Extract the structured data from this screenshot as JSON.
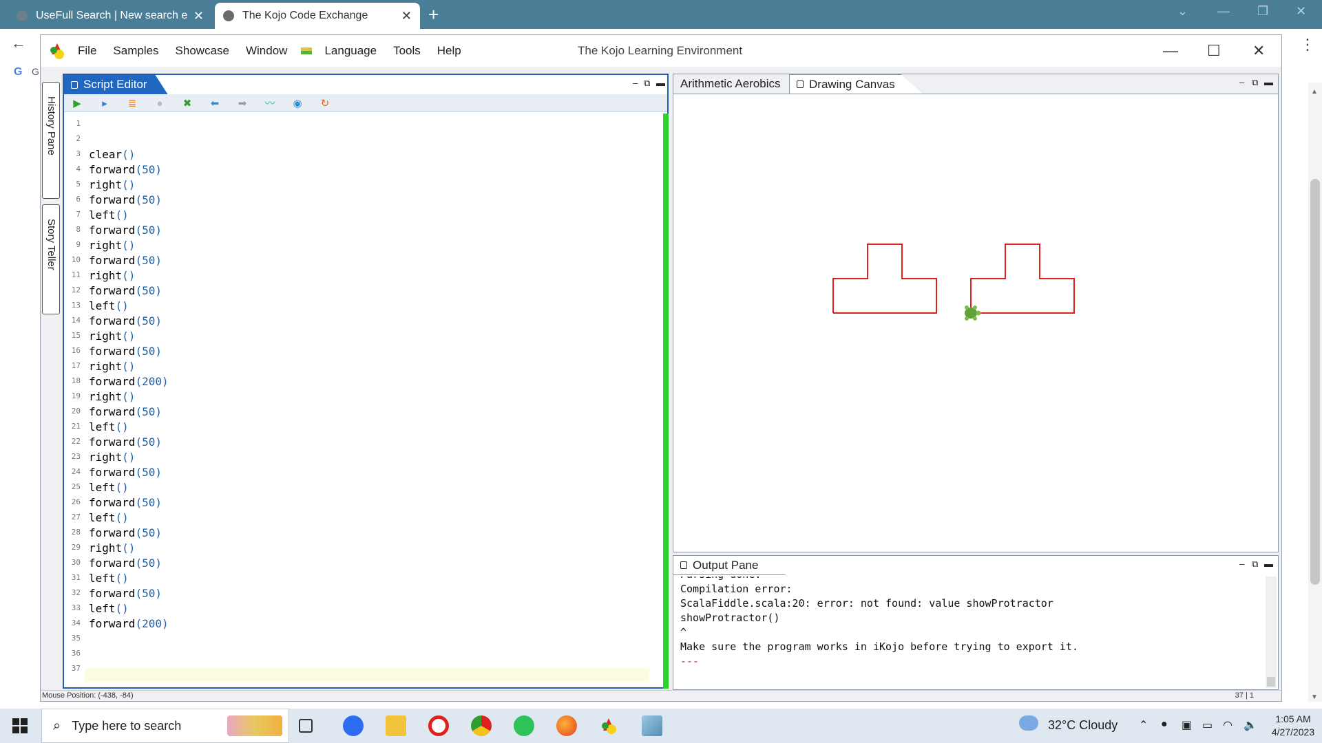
{
  "browser": {
    "tabs": [
      {
        "title": "UseFull Search | New search engi",
        "active": false
      },
      {
        "title": "The Kojo Code Exchange",
        "active": true
      }
    ],
    "new_tab": "+",
    "google_prefix": "G"
  },
  "kojo": {
    "window_title": "The Kojo Learning Environment",
    "menu": [
      "File",
      "Samples",
      "Showcase",
      "Window",
      "Language",
      "Tools",
      "Help"
    ],
    "side_tabs": [
      "History Pane",
      "Story Teller"
    ],
    "editor": {
      "tab_label": "Script Editor",
      "code_lines": [
        {
          "n": "1",
          "f": "",
          "a": ""
        },
        {
          "n": "2",
          "f": "",
          "a": ""
        },
        {
          "n": "3",
          "f": "clear",
          "a": "()"
        },
        {
          "n": "4",
          "f": "forward",
          "a": "(50)"
        },
        {
          "n": "5",
          "f": "right",
          "a": "()"
        },
        {
          "n": "6",
          "f": "forward",
          "a": "(50)"
        },
        {
          "n": "7",
          "f": "left",
          "a": "()"
        },
        {
          "n": "8",
          "f": "forward",
          "a": "(50)"
        },
        {
          "n": "9",
          "f": "right",
          "a": "()"
        },
        {
          "n": "10",
          "f": "forward",
          "a": "(50)"
        },
        {
          "n": "11",
          "f": "right",
          "a": "()"
        },
        {
          "n": "12",
          "f": "forward",
          "a": "(50)"
        },
        {
          "n": "13",
          "f": "left",
          "a": "()"
        },
        {
          "n": "14",
          "f": "forward",
          "a": "(50)"
        },
        {
          "n": "15",
          "f": "right",
          "a": "()"
        },
        {
          "n": "16",
          "f": "forward",
          "a": "(50)"
        },
        {
          "n": "17",
          "f": "right",
          "a": "()"
        },
        {
          "n": "18",
          "f": "forward",
          "a": "(200)"
        },
        {
          "n": "19",
          "f": "right",
          "a": "()"
        },
        {
          "n": "20",
          "f": "forward",
          "a": "(50)"
        },
        {
          "n": "21",
          "f": "left",
          "a": "()"
        },
        {
          "n": "22",
          "f": "forward",
          "a": "(50)"
        },
        {
          "n": "23",
          "f": "right",
          "a": "()"
        },
        {
          "n": "24",
          "f": "forward",
          "a": "(50)"
        },
        {
          "n": "25",
          "f": "left",
          "a": "()"
        },
        {
          "n": "26",
          "f": "forward",
          "a": "(50)"
        },
        {
          "n": "27",
          "f": "left",
          "a": "()"
        },
        {
          "n": "28",
          "f": "forward",
          "a": "(50)"
        },
        {
          "n": "29",
          "f": "right",
          "a": "()"
        },
        {
          "n": "30",
          "f": "forward",
          "a": "(50)"
        },
        {
          "n": "31",
          "f": "left",
          "a": "()"
        },
        {
          "n": "32",
          "f": "forward",
          "a": "(50)"
        },
        {
          "n": "33",
          "f": "left",
          "a": "()"
        },
        {
          "n": "34",
          "f": "forward",
          "a": "(200)"
        },
        {
          "n": "35",
          "f": "",
          "a": ""
        },
        {
          "n": "36",
          "f": "",
          "a": ""
        },
        {
          "n": "37",
          "f": "",
          "a": ""
        }
      ]
    },
    "canvas_tabs": [
      "Arithmetic Aerobics",
      "Drawing Canvas"
    ],
    "output": {
      "tab_label": "Output Pane",
      "lines": [
        {
          "text": "Parsing done.",
          "red": false
        },
        {
          "text": "Compilation error:",
          "red": false
        },
        {
          "text": "ScalaFiddle.scala:20: error: not found: value showProtractor",
          "red": false
        },
        {
          "text": "showProtractor()",
          "red": false
        },
        {
          "text": "^",
          "red": false
        },
        {
          "text": "Make sure the program works in iKojo before trying to export it.",
          "red": false
        },
        {
          "text": "---",
          "red": true
        }
      ]
    },
    "status": {
      "mouse_position": "Mouse Position: (-438, -84)",
      "cursor": "37 | 1"
    }
  },
  "taskbar": {
    "search_placeholder": "Type here to search",
    "weather": "32°C  Cloudy",
    "time": "1:05 AM",
    "date": "4/27/2023"
  },
  "colors": {
    "accent": "#1f67c1",
    "tabbar": "#4a7d96",
    "drawing_line": "#e0201a",
    "run_bar": "#2bd32b"
  }
}
